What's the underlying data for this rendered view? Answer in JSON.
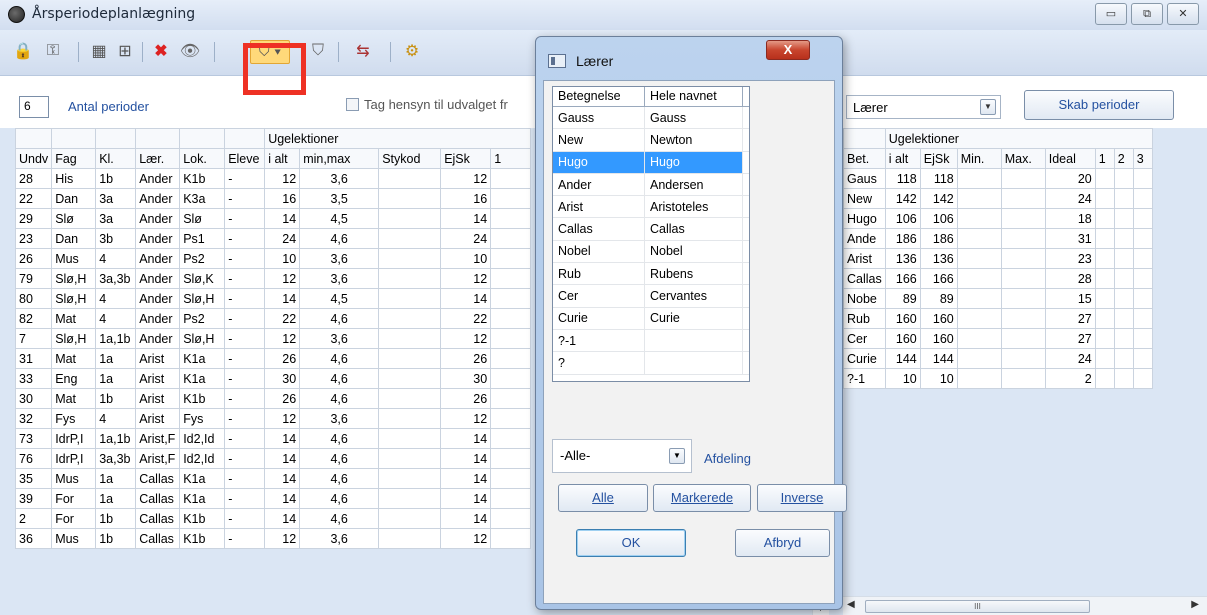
{
  "window": {
    "title": "Årsperiodeplanlægning",
    "controls": [
      "▭",
      "⧉",
      "✕"
    ]
  },
  "toolbar": {
    "icons": [
      "lock-icon",
      "key-icon",
      "calculator-icon",
      "book-icon",
      "delete-icon",
      "eye-icon",
      "filter-icon",
      "filter-clear-icon",
      "export-icon",
      "settings-icon"
    ],
    "filter_arrow": "▾"
  },
  "options": {
    "periods_value": "6",
    "periods_label": "Antal perioder",
    "hensyn_label": "Tag hensyn til udvalget fr",
    "laerer_select": "Lærer",
    "skab_button": "Skab perioder"
  },
  "left_grid": {
    "group_header": "Ugelektioner",
    "columns": [
      "Undv",
      "Fag",
      "Kl.",
      "Lær.",
      "Lok.",
      "Eleve",
      "i alt",
      "min,max",
      "Stykod",
      "EjSk",
      "1"
    ],
    "rows": [
      [
        "28",
        "His",
        "1b",
        "Ander",
        "K1b",
        "-",
        "12",
        "3,6",
        "",
        "12"
      ],
      [
        "22",
        "Dan",
        "3a",
        "Ander",
        "K3a",
        "-",
        "16",
        "3,5",
        "",
        "16"
      ],
      [
        "29",
        "Slø",
        "3a",
        "Ander",
        "Slø",
        "-",
        "14",
        "4,5",
        "",
        "14"
      ],
      [
        "23",
        "Dan",
        "3b",
        "Ander",
        "Ps1",
        "-",
        "24",
        "4,6",
        "",
        "24"
      ],
      [
        "26",
        "Mus",
        "4",
        "Ander",
        "Ps2",
        "-",
        "10",
        "3,6",
        "",
        "10"
      ],
      [
        "79",
        "Slø,H",
        "3a,3b",
        "Ander",
        "Slø,K",
        "-",
        "12",
        "3,6",
        "",
        "12"
      ],
      [
        "80",
        "Slø,H",
        "4",
        "Ander",
        "Slø,H",
        "-",
        "14",
        "4,5",
        "",
        "14"
      ],
      [
        "82",
        "Mat",
        "4",
        "Ander",
        "Ps2",
        "-",
        "22",
        "4,6",
        "",
        "22"
      ],
      [
        "7",
        "Slø,H",
        "1a,1b",
        "Ander",
        "Slø,H",
        "-",
        "12",
        "3,6",
        "",
        "12"
      ],
      [
        "31",
        "Mat",
        "1a",
        "Arist",
        "K1a",
        "-",
        "26",
        "4,6",
        "",
        "26"
      ],
      [
        "33",
        "Eng",
        "1a",
        "Arist",
        "K1a",
        "-",
        "30",
        "4,6",
        "",
        "30"
      ],
      [
        "30",
        "Mat",
        "1b",
        "Arist",
        "K1b",
        "-",
        "26",
        "4,6",
        "",
        "26"
      ],
      [
        "32",
        "Fys",
        "4",
        "Arist",
        "Fys",
        "-",
        "12",
        "3,6",
        "",
        "12"
      ],
      [
        "73",
        "IdrP,I",
        "1a,1b",
        "Arist,F",
        "Id2,Id",
        "-",
        "14",
        "4,6",
        "",
        "14"
      ],
      [
        "76",
        "IdrP,I",
        "3a,3b",
        "Arist,F",
        "Id2,Id",
        "-",
        "14",
        "4,6",
        "",
        "14"
      ],
      [
        "35",
        "Mus",
        "1a",
        "Callas",
        "K1a",
        "-",
        "14",
        "4,6",
        "",
        "14"
      ],
      [
        "39",
        "For",
        "1a",
        "Callas",
        "K1a",
        "-",
        "14",
        "4,6",
        "",
        "14"
      ],
      [
        "2",
        "For",
        "1b",
        "Callas",
        "K1b",
        "-",
        "14",
        "4,6",
        "",
        "14"
      ],
      [
        "36",
        "Mus",
        "1b",
        "Callas",
        "K1b",
        "-",
        "12",
        "3,6",
        "",
        "12"
      ]
    ]
  },
  "right_grid": {
    "group_header": "Ugelektioner",
    "columns": [
      "Bet.",
      "i alt",
      "EjSk",
      "Min.",
      "Max.",
      "Ideal",
      "1",
      "2",
      "3"
    ],
    "rows": [
      [
        "Gaus",
        "118",
        "118",
        "",
        "",
        "20"
      ],
      [
        "New",
        "142",
        "142",
        "",
        "",
        "24"
      ],
      [
        "Hugo",
        "106",
        "106",
        "",
        "",
        "18"
      ],
      [
        "Ande",
        "186",
        "186",
        "",
        "",
        "31"
      ],
      [
        "Arist",
        "136",
        "136",
        "",
        "",
        "23"
      ],
      [
        "Callas",
        "166",
        "166",
        "",
        "",
        "28"
      ],
      [
        "Nobe",
        "89",
        "89",
        "",
        "",
        "15"
      ],
      [
        "Rub",
        "160",
        "160",
        "",
        "",
        "27"
      ],
      [
        "Cer",
        "160",
        "160",
        "",
        "",
        "27"
      ],
      [
        "Curie",
        "144",
        "144",
        "",
        "",
        "24"
      ],
      [
        "?-1",
        "10",
        "10",
        "",
        "",
        "2"
      ]
    ],
    "scroll_thumb": "III"
  },
  "dialog": {
    "title": "Lærer",
    "close": "X",
    "columns": [
      "Betegnelse",
      "Hele navnet"
    ],
    "rows": [
      [
        "Gauss",
        "Gauss"
      ],
      [
        "New",
        "Newton"
      ],
      [
        "Hugo",
        "Hugo"
      ],
      [
        "Ander",
        "Andersen"
      ],
      [
        "Arist",
        "Aristoteles"
      ],
      [
        "Callas",
        "Callas"
      ],
      [
        "Nobel",
        "Nobel"
      ],
      [
        "Rub",
        "Rubens"
      ],
      [
        "Cer",
        "Cervantes"
      ],
      [
        "Curie",
        "Curie"
      ],
      [
        "?-1",
        ""
      ],
      [
        "?",
        ""
      ]
    ],
    "selected_index": 2,
    "afdeling_value": "-Alle-",
    "afdeling_label": "Afdeling",
    "btn_alle": "Alle",
    "btn_markerede": "Markerede",
    "btn_inverse": "Inverse",
    "btn_ok": "OK",
    "btn_afbryd": "Afbryd"
  }
}
